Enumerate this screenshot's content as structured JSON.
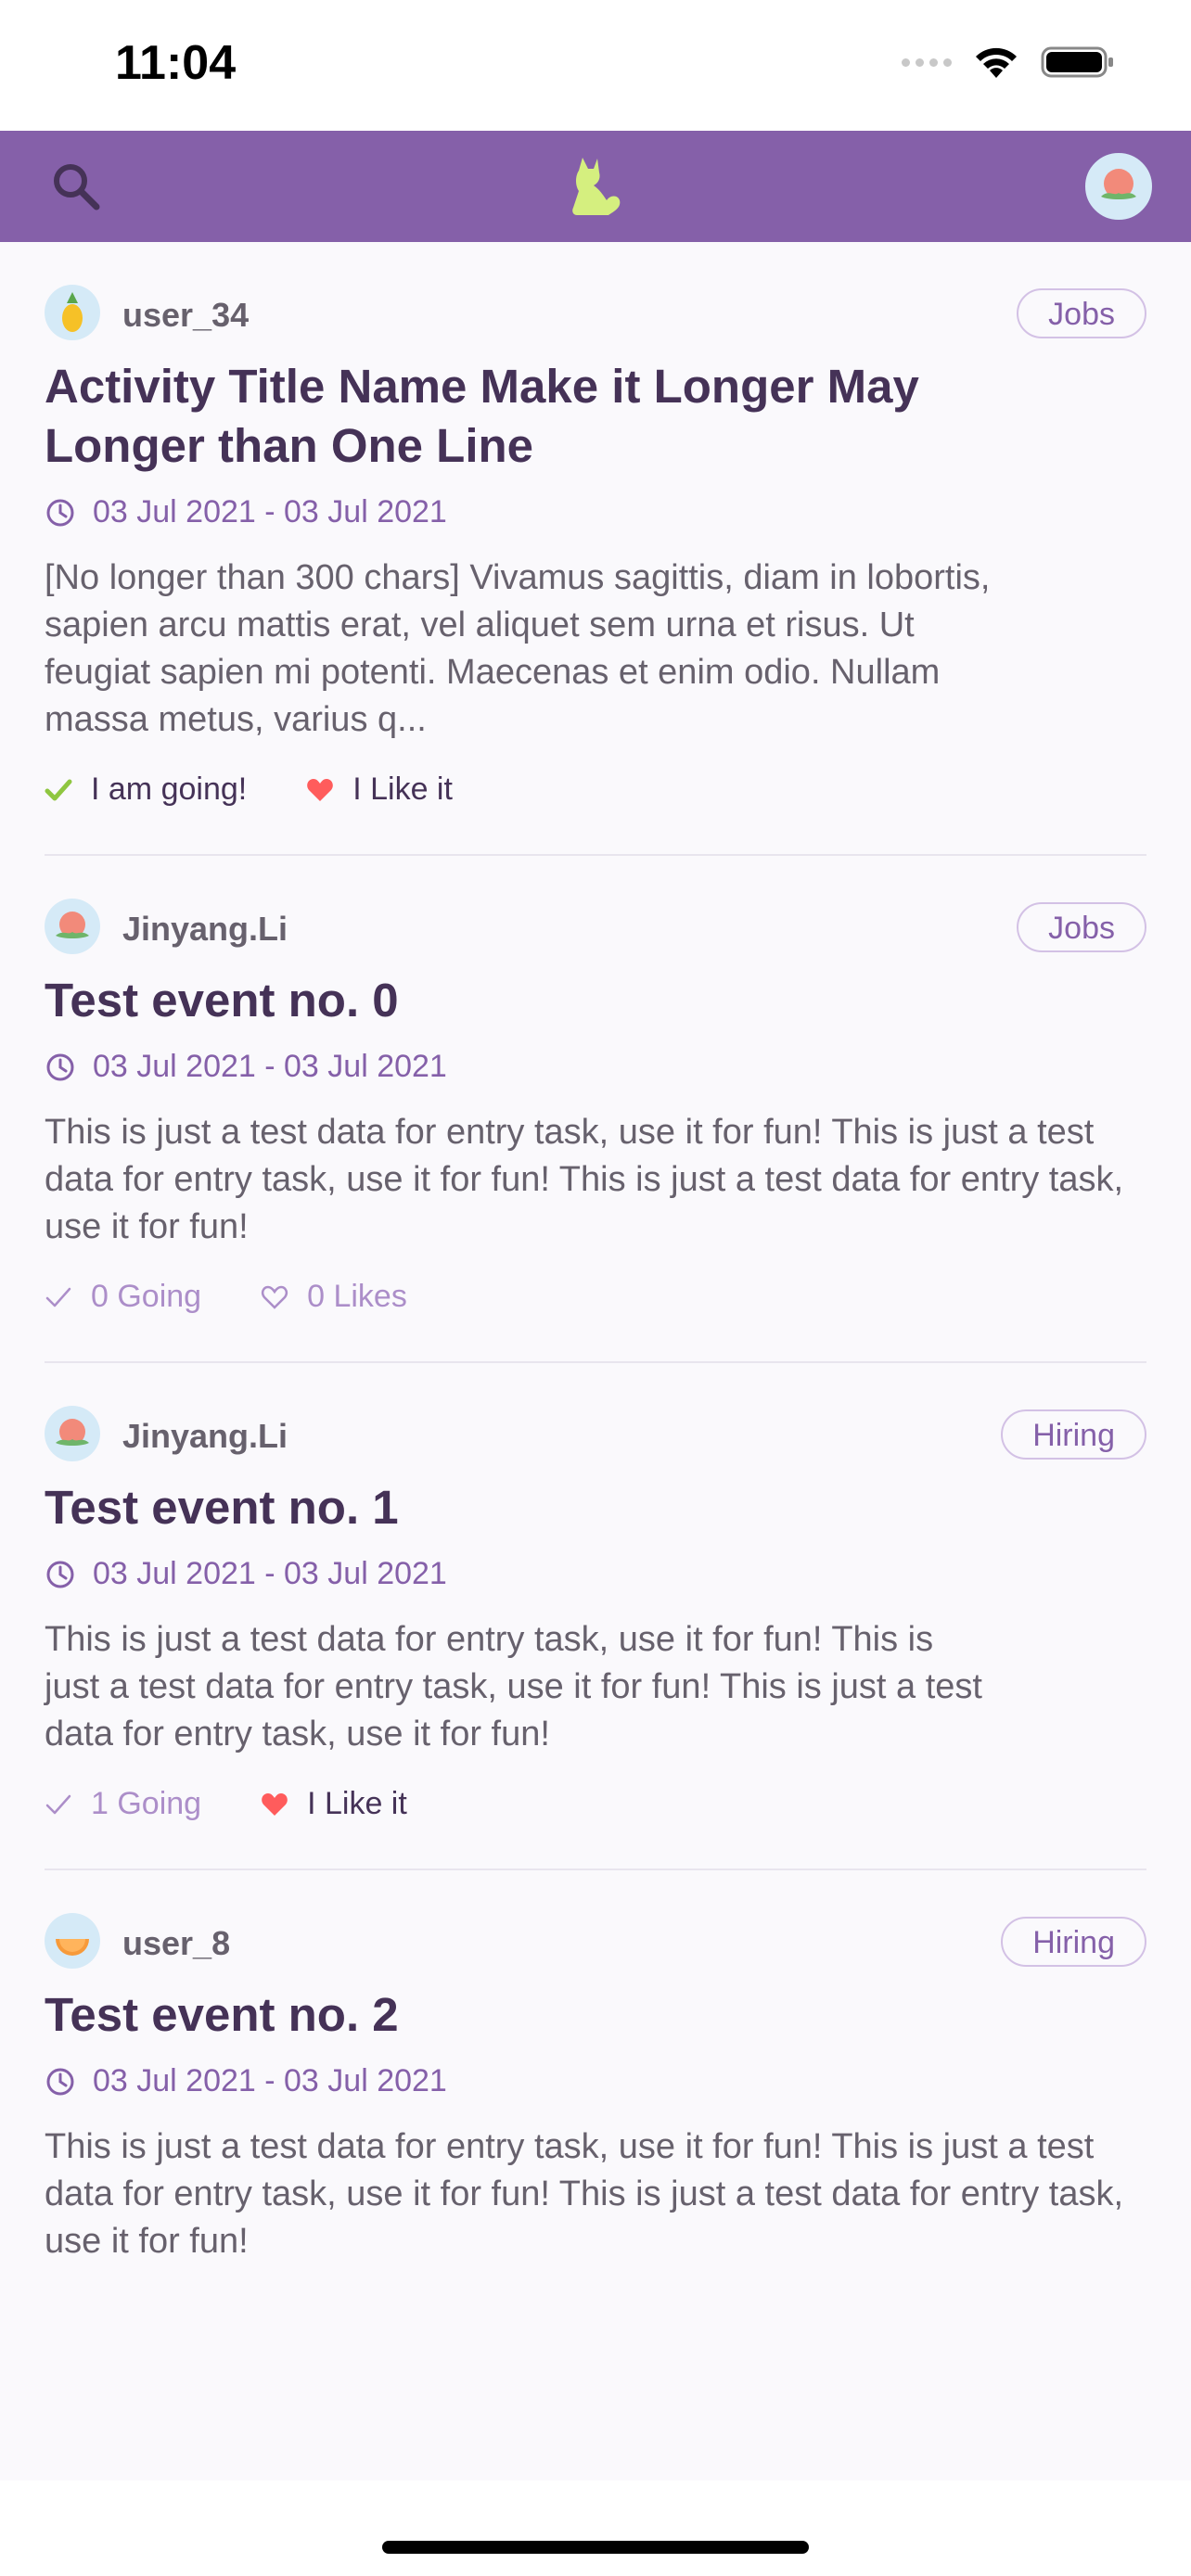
{
  "status_bar": {
    "time": "11:04"
  },
  "nav": {
    "search_icon": "search-icon",
    "logo_icon": "cat-logo-icon",
    "avatar_icon": "peach-avatar-icon",
    "colors": {
      "bar": "#8560a9",
      "logo": "#d5ef7f"
    }
  },
  "cards": [
    {
      "user": "user_34",
      "avatar": "pineapple",
      "tag": "Jobs",
      "title": "Activity Title Name Make it Longer May Longer than One Line",
      "date": "03 Jul 2021 - 03 Jul 2021",
      "description": "[No longer than 300 chars] Vivamus sagittis, diam in lobortis, sapien arcu mattis erat, vel aliquet sem urna et risus. Ut feugiat sapien mi potenti. Maecenas et enim odio. Nullam massa metus, varius q...",
      "going": "I am going!",
      "like": "I Like it"
    },
    {
      "user": "Jinyang.Li",
      "avatar": "peach",
      "tag": "Jobs",
      "title": "Test event no. 0",
      "date": "03 Jul 2021 - 03 Jul 2021",
      "description": "This is just a test data for entry task, use it for fun! This is just a test data for entry task, use it for fun! This is just a test data for entry task, use it for fun!",
      "going": "0 Going",
      "like": "0 Likes"
    },
    {
      "user": "Jinyang.Li",
      "avatar": "peach",
      "tag": "Hiring",
      "title": "Test event no. 1",
      "date": "03 Jul 2021 - 03 Jul 2021",
      "description": "This is just a test data for entry task, use it for fun! This is just a test data for entry task, use it for fun! This is just a test data for entry task, use it for fun!",
      "going": "1 Going",
      "like": "I Like it"
    },
    {
      "user": "user_8",
      "avatar": "melon",
      "tag": "Hiring",
      "title": "Test event no. 2",
      "date": "03 Jul 2021 - 03 Jul 2021",
      "description": "This is just a test data for entry task, use it for fun! This is just a test data for entry task, use it for fun! This is just a test data for entry task, use it for fun!"
    }
  ],
  "colors": {
    "primary": "#8560a9",
    "title": "#453257",
    "muted": "#ac8ec9",
    "check": "#8fc640",
    "heart": "#ff5c5c"
  }
}
